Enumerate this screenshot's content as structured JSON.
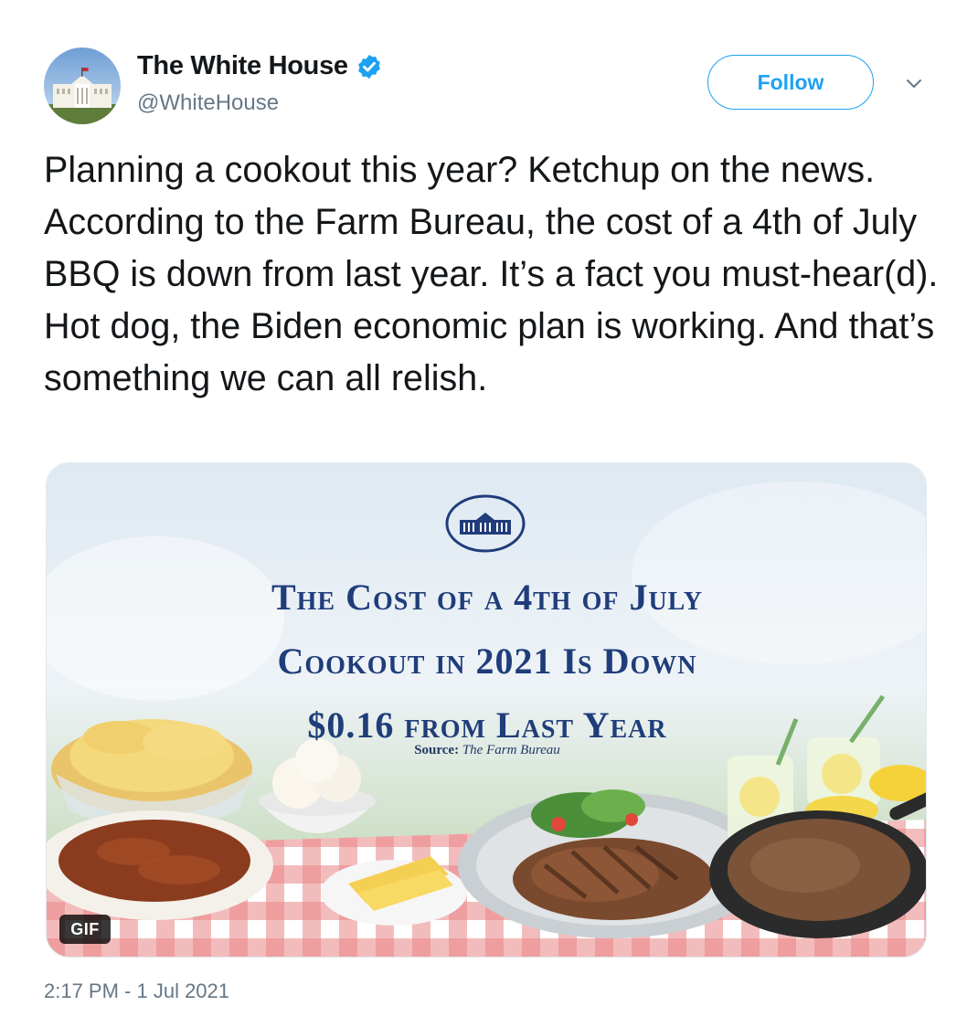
{
  "tweet": {
    "author_name": "The White House",
    "author_handle": "@WhiteHouse",
    "verified": true,
    "follow_label": "Follow",
    "text": "Planning a cookout this year? Ketchup on the news. According to the Farm Bureau, the cost of a 4th of July BBQ is down from last year. It’s a fact you must-hear(d). Hot dog, the Biden economic plan is working. And that’s something we can all relish.",
    "timestamp": "2:17 PM - 1 Jul 2021"
  },
  "media": {
    "headline_line1": "The Cost of a 4th of July",
    "headline_line2": "Cookout in 2021 Is Down",
    "headline_line3": "$0.16 from Last Year",
    "source_label": "Source:",
    "source_value": "The Farm Bureau",
    "gif_badge": "GIF"
  },
  "colors": {
    "accent": "#1da1f2",
    "headline": "#1f3d7a",
    "muted": "#657786"
  },
  "icons": [
    "verified-badge-icon",
    "chevron-down-icon",
    "white-house-seal-icon"
  ]
}
